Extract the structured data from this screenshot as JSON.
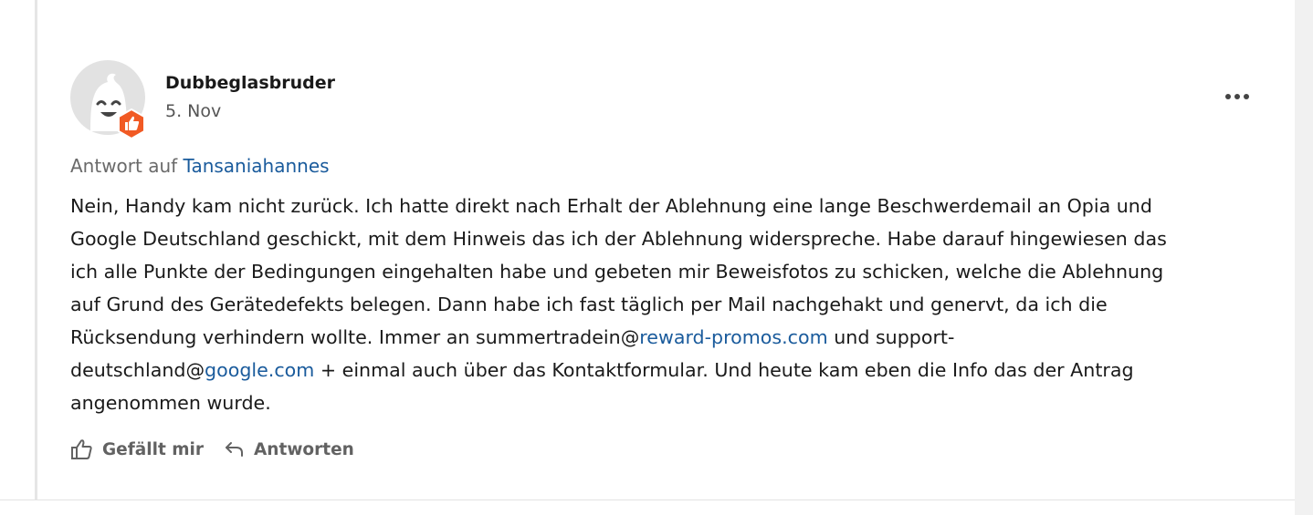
{
  "post": {
    "author": "Dubbeglasbruder",
    "date": "5. Nov",
    "avatar_icon": "ghost-avatar-icon",
    "badge_icon": "thumbs-up-badge-icon",
    "badge_color": "#f15a24",
    "reply_prefix": "Antwort auf",
    "reply_to_user": "Tansaniahannes",
    "body": {
      "line1": "Nein, Handy kam nicht zurück. Ich hatte direkt nach Erhalt der Ablehnung eine lange Beschwerdemail an Opia und",
      "line2": "Google Deutschland geschickt, mit dem Hinweis das ich der Ablehnung widerspreche. Habe darauf hingewiesen das",
      "line3": "ich alle Punkte der Bedingungen eingehalten habe und gebeten mir Beweisfotos zu schicken, welche die Ablehnung",
      "line4": "auf Grund des Gerätedefekts belegen. Dann habe ich fast täglich per Mail nachgehakt und genervt, da ich die",
      "line5_pre": "Rücksendung verhindern wollte. Immer an summertradein@",
      "line5_link": "reward-promos.com",
      "line5_post": " und support-",
      "line6_pre": "deutschland@",
      "line6_link": "google.com",
      "line6_post": " + einmal auch über das Kontaktformular. Und heute kam eben die Info das der Antrag",
      "line7": "angenommen wurde."
    },
    "actions": {
      "like_label": "Gefällt mir",
      "reply_label": "Antworten"
    }
  },
  "colors": {
    "link": "#1a5b9c",
    "muted": "#6a6a6a",
    "action": "#626262"
  }
}
